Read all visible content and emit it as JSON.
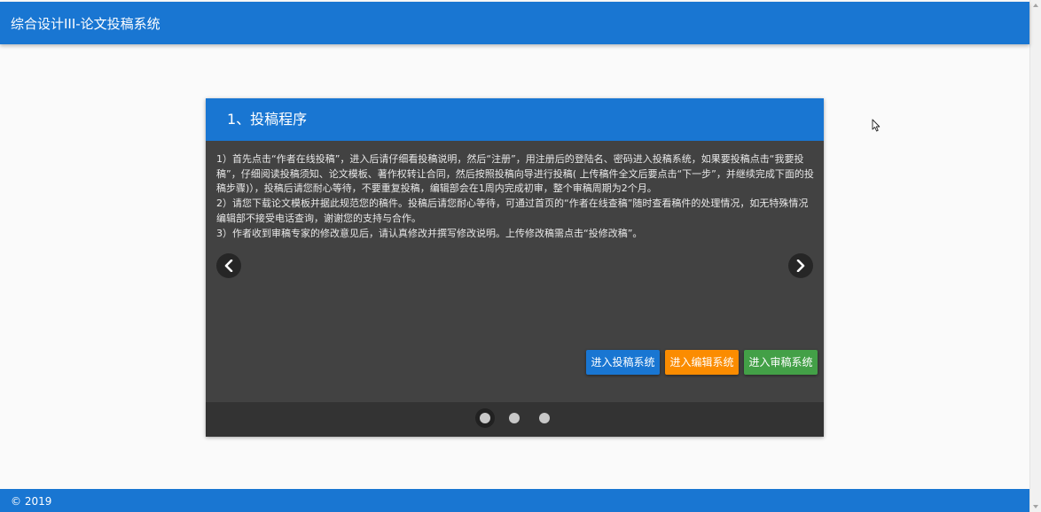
{
  "header": {
    "title": "综合设计III-论文投稿系统"
  },
  "carousel": {
    "active_index": 0,
    "slides_count": 3,
    "slide": {
      "title": "1、投稿程序",
      "paragraphs": [
        "1）首先点击“作者在线投稿”，进入后请仔细看投稿说明，然后“注册”，用注册后的登陆名、密码进入投稿系统，如果要投稿点击“我要投稿”，仔细阅读投稿须知、论文模板、著作权转让合同，然后按照投稿向导进行投稿( 上传稿件全文后要点击“下一步”，并继续完成下面的投稿步骤)），投稿后请您耐心等待，不要重复投稿，编辑部会在1周内完成初审，整个审稿周期为2个月。",
        "2）请您下载论文模板并据此规范您的稿件。投稿后请您耐心等待，可通过首页的“作者在线查稿”随时查看稿件的处理情况，如无特殊情况编辑部不接受电话查询，谢谢您的支持与合作。",
        "3）作者收到审稿专家的修改意见后，请认真修改并撰写修改说明。上传修改稿需点击“投修改稿”。"
      ]
    },
    "prev_icon": "chevron-left-icon",
    "next_icon": "chevron-right-icon",
    "buttons": {
      "submit": "进入投稿系统",
      "editor": "进入编辑系统",
      "review": "进入审稿系统"
    }
  },
  "footer": {
    "copyright": "© 2019"
  },
  "colors": {
    "primary": "#1976d2",
    "card_bg": "#424242",
    "indicator_bg": "#333333",
    "editor_button": "#fb8c00",
    "review_button": "#43a047",
    "page_bg": "#fafafa"
  }
}
